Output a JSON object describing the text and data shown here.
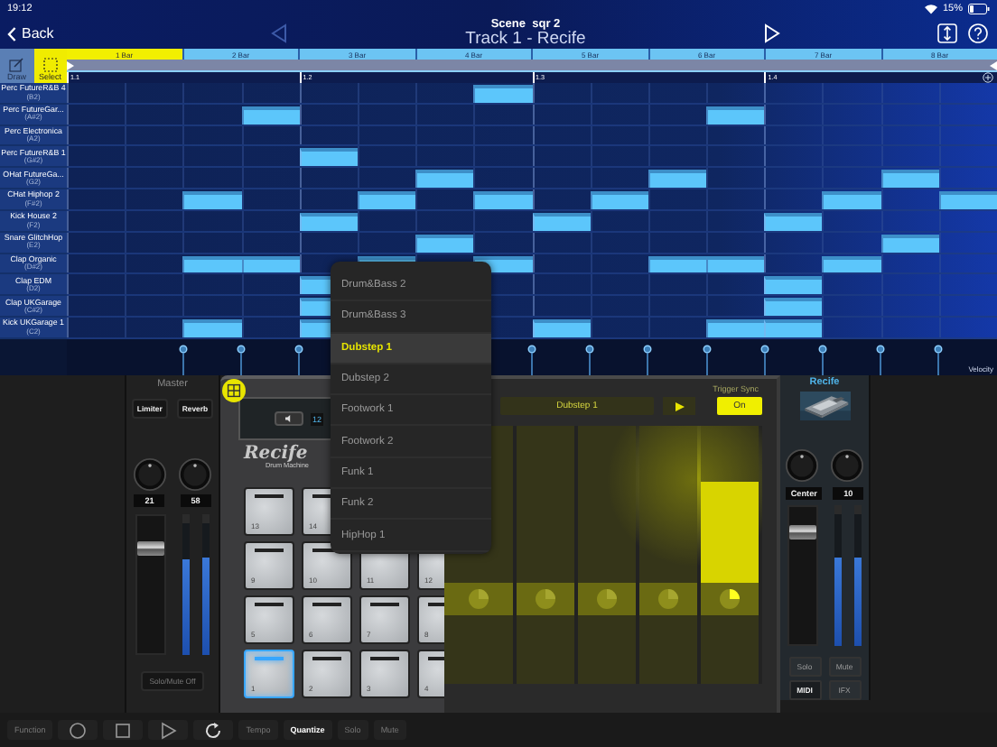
{
  "status_bar": {
    "time": "19:12",
    "battery": "15%"
  },
  "nav": {
    "back": "Back",
    "scene": "Scene  sqr 2",
    "title": "Track 1 - Recife",
    "prev_disabled": true
  },
  "tools": [
    {
      "label": "Draw",
      "selected": false
    },
    {
      "label": "Select",
      "selected": true
    }
  ],
  "bars": [
    {
      "label": "1 Bar",
      "selected": true
    },
    {
      "label": "2 Bar",
      "selected": false
    },
    {
      "label": "3 Bar",
      "selected": false
    },
    {
      "label": "4 Bar",
      "selected": false
    },
    {
      "label": "5 Bar",
      "selected": false
    },
    {
      "label": "6 Bar",
      "selected": false
    },
    {
      "label": "7 Bar",
      "selected": false
    },
    {
      "label": "8 Bar",
      "selected": false
    }
  ],
  "positions": [
    "1.1",
    "1.2",
    "1.3",
    "1.4"
  ],
  "rows": [
    {
      "name": "Perc FutureR&B 4",
      "note": "(B2)",
      "beats": [
        [
          false,
          false,
          false,
          false
        ],
        [
          false,
          false,
          false,
          true
        ],
        [
          false,
          false,
          false,
          false
        ],
        [
          false,
          false,
          false,
          false
        ]
      ]
    },
    {
      "name": "Perc FutureGar...",
      "note": "(A#2)",
      "beats": [
        [
          false,
          false,
          false,
          true
        ],
        [
          false,
          false,
          false,
          false
        ],
        [
          false,
          false,
          false,
          true
        ],
        [
          false,
          false,
          false,
          false
        ]
      ]
    },
    {
      "name": "Perc Electronica",
      "note": "(A2)",
      "beats": [
        [
          false,
          false,
          false,
          false
        ],
        [
          false,
          false,
          false,
          false
        ],
        [
          false,
          false,
          false,
          false
        ],
        [
          false,
          false,
          false,
          false
        ]
      ]
    },
    {
      "name": "Perc FutureR&B 1",
      "note": "(G#2)",
      "beats": [
        [
          false,
          false,
          false,
          false
        ],
        [
          true,
          false,
          false,
          false
        ],
        [
          false,
          false,
          false,
          false
        ],
        [
          false,
          false,
          false,
          false
        ]
      ]
    },
    {
      "name": "OHat FutureGa...",
      "note": "(G2)",
      "beats": [
        [
          false,
          false,
          false,
          false
        ],
        [
          false,
          false,
          true,
          false
        ],
        [
          false,
          false,
          true,
          false
        ],
        [
          false,
          false,
          true,
          false
        ]
      ]
    },
    {
      "name": "CHat Hiphop 2",
      "note": "(F#2)",
      "beats": [
        [
          false,
          false,
          true,
          false
        ],
        [
          false,
          true,
          false,
          true
        ],
        [
          false,
          true,
          false,
          false
        ],
        [
          false,
          true,
          false,
          true
        ]
      ]
    },
    {
      "name": "Kick House 2",
      "note": "(F2)",
      "beats": [
        [
          false,
          false,
          false,
          false
        ],
        [
          true,
          false,
          false,
          false
        ],
        [
          true,
          false,
          false,
          false
        ],
        [
          true,
          false,
          false,
          false
        ]
      ]
    },
    {
      "name": "Snare GlitchHop",
      "note": "(E2)",
      "beats": [
        [
          false,
          false,
          false,
          false
        ],
        [
          false,
          false,
          true,
          false
        ],
        [
          false,
          false,
          false,
          false
        ],
        [
          false,
          false,
          true,
          false
        ]
      ]
    },
    {
      "name": "Clap Organic",
      "note": "(D#2)",
      "beats": [
        [
          false,
          false,
          true,
          true
        ],
        [
          false,
          true,
          false,
          true
        ],
        [
          false,
          false,
          true,
          true
        ],
        [
          false,
          true,
          false,
          false
        ]
      ]
    },
    {
      "name": "Clap EDM",
      "note": "(D2)",
      "beats": [
        [
          false,
          false,
          false,
          false
        ],
        [
          true
        ],
        [
          false,
          false,
          false,
          false
        ],
        [
          true,
          false,
          false,
          false
        ]
      ]
    },
    {
      "name": "Clap UKGarage",
      "note": "(C#2)",
      "beats": [
        [
          false,
          false,
          false,
          false
        ],
        [
          true
        ],
        [
          false,
          false,
          false,
          false
        ],
        [
          true,
          false,
          false,
          false
        ]
      ]
    },
    {
      "name": "Kick UKGarage 1",
      "note": "(C2)",
      "beats": [
        [
          false,
          false,
          true,
          false
        ],
        [
          true
        ],
        [
          true,
          false,
          false,
          true
        ],
        [
          true,
          false,
          false,
          false
        ]
      ]
    }
  ],
  "velocity_label": "Velocity",
  "master": {
    "title": "Master",
    "buttons": [
      "Limiter",
      "Reverb"
    ],
    "values": [
      "21",
      "58"
    ],
    "fader": {
      "level": 0.8
    },
    "meters": [
      {
        "level": 0.72
      },
      {
        "level": 0.74
      }
    ],
    "solo_mute": "Solo/Mute Off"
  },
  "drum_machine": {
    "display_value": "12",
    "logo": "Recife",
    "subtitle": "Drum Machine",
    "pad_rows": [
      [
        {
          "label": "13",
          "lit": false
        },
        {
          "label": "14",
          "lit": false
        }
      ],
      [
        {
          "label": "9",
          "lit": false
        },
        {
          "label": "10",
          "lit": false
        },
        {
          "label": "11",
          "lit": false
        },
        {
          "label": "12",
          "lit": false
        }
      ],
      [
        {
          "label": "5",
          "lit": false
        },
        {
          "label": "6",
          "lit": false
        },
        {
          "label": "7",
          "lit": false
        },
        {
          "label": "8",
          "lit": false
        }
      ],
      [
        {
          "label": "1",
          "lit": true
        },
        {
          "label": "2",
          "lit": false
        },
        {
          "label": "3",
          "lit": false
        },
        {
          "label": "4",
          "lit": false
        }
      ]
    ]
  },
  "trigger": {
    "sync_label": "Trigger Sync",
    "pattern": "Dubstep 1",
    "sync": "On",
    "sync_on": true,
    "columns": [
      {
        "active": false
      },
      {
        "active": false
      },
      {
        "active": false
      },
      {
        "active": false
      },
      {
        "active": true
      }
    ]
  },
  "channel": {
    "title": "Recife",
    "values": [
      "Center",
      "10"
    ],
    "fader": {
      "level": 0.86
    },
    "meters": [
      {
        "level": 0.67
      },
      {
        "level": 0.67
      }
    ],
    "buttons": [
      {
        "label": "Solo",
        "on": false
      },
      {
        "label": "Mute",
        "on": false
      },
      {
        "label": "MIDI",
        "on": true
      },
      {
        "label": "IFX",
        "on": false
      }
    ]
  },
  "menu": {
    "items": [
      {
        "label": "Drum&Bass 2",
        "selected": false
      },
      {
        "label": "Drum&Bass 3",
        "selected": false
      },
      {
        "label": "Dubstep 1",
        "selected": true
      },
      {
        "label": "Dubstep 2",
        "selected": false
      },
      {
        "label": "Footwork 1",
        "selected": false
      },
      {
        "label": "Footwork 2",
        "selected": false
      },
      {
        "label": "Funk 1",
        "selected": false
      },
      {
        "label": "Funk 2",
        "selected": false
      },
      {
        "label": "HipHop 1",
        "selected": false
      }
    ]
  },
  "toolbar": [
    {
      "kind": "text",
      "label": "Function",
      "selected": false
    },
    {
      "kind": "record"
    },
    {
      "kind": "stop"
    },
    {
      "kind": "play"
    },
    {
      "kind": "loop"
    },
    {
      "kind": "text",
      "label": "Tempo",
      "selected": false
    },
    {
      "kind": "text",
      "label": "Quantize",
      "selected": true
    },
    {
      "kind": "text",
      "label": "Solo",
      "selected": false
    },
    {
      "kind": "text",
      "label": "Mute",
      "selected": false
    }
  ]
}
